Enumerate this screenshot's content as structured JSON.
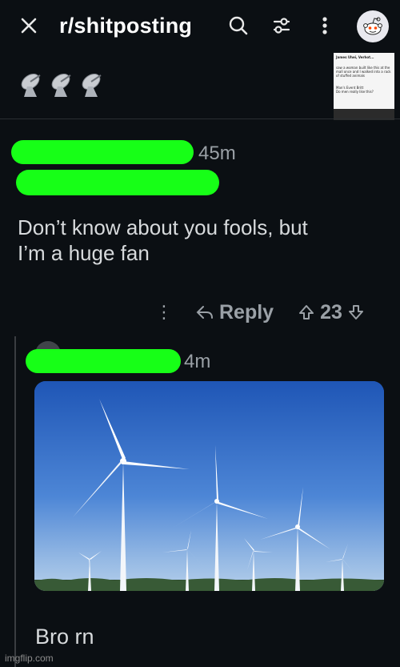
{
  "header": {
    "title": "r/shitposting",
    "close_icon": "close-icon",
    "search_icon": "search-icon",
    "filter_icon": "filter-icon",
    "more_icon": "more-icon",
    "avatar_icon": "reddit-avatar-icon"
  },
  "post": {
    "emojis": "📡📡📡",
    "thumbnail_text": [
      "James Uhei, Verhot...",
      "saw a woman built like this at the mall once and I walked into a rack of stuffed animals",
      "Man's Event Britt",
      "Do men really like this?"
    ]
  },
  "comment1": {
    "time": "45m",
    "text_line1": "Don’t know about you fools, but",
    "text_line2": "I’m a huge fan",
    "more_label": "⋮",
    "reply_label": "Reply",
    "vote_count": "23"
  },
  "comment2": {
    "time": "4m",
    "text": "Bro rn"
  },
  "watermark": "imgflip.com",
  "colors": {
    "background": "#0b0f13",
    "redaction": "#17ff17",
    "muted": "#9aa0a6"
  }
}
